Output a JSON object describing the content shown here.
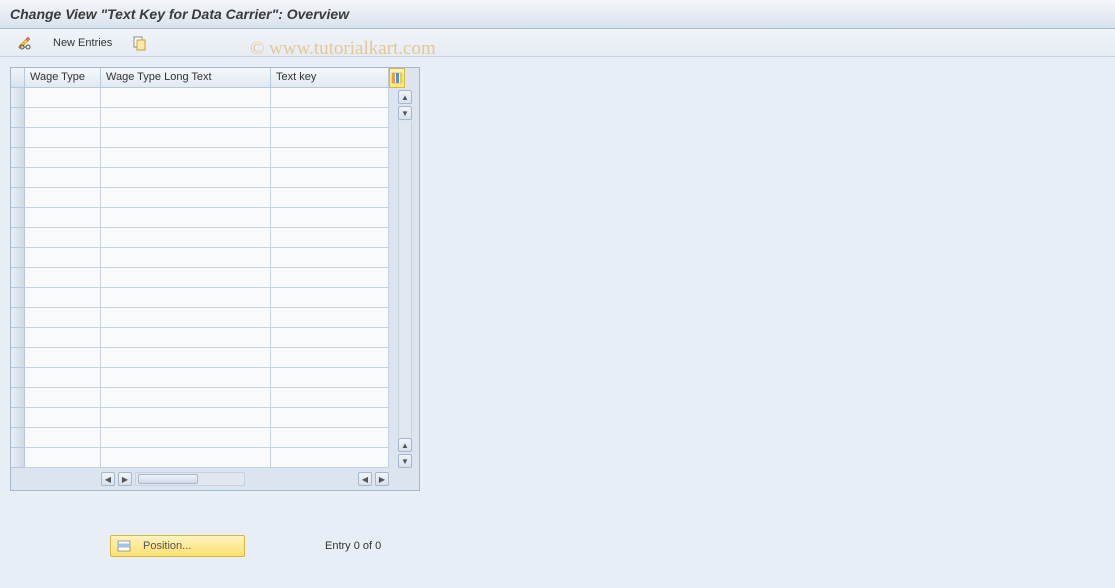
{
  "title": "Change View \"Text Key for Data Carrier\": Overview",
  "toolbar": {
    "new_entries_label": "New Entries"
  },
  "table": {
    "columns": [
      "Wage Type",
      "Wage Type Long Text",
      "Text key"
    ],
    "row_count": 19
  },
  "footer": {
    "position_label": "Position...",
    "entry_text": "Entry 0 of 0"
  },
  "watermark": "© www.tutorialkart.com"
}
